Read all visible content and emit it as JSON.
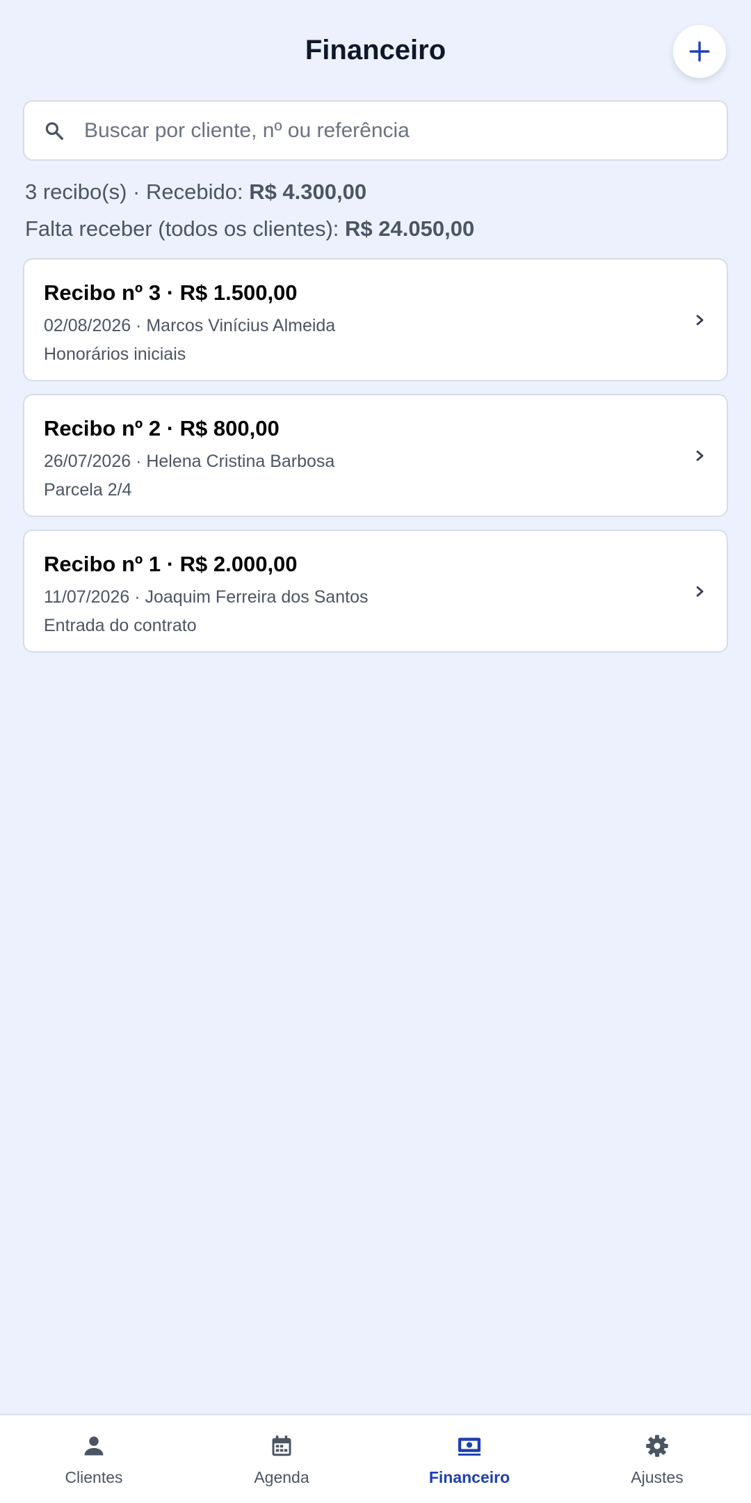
{
  "header": {
    "title": "Financeiro",
    "add_icon": "plus-icon"
  },
  "search": {
    "placeholder": "Buscar por cliente, nº ou referência",
    "value": "",
    "icon": "search-icon"
  },
  "summary": {
    "count_text": "3 recibo(s) · Recebido: ",
    "received_amount": "R$ 4.300,00",
    "pending_label": "Falta receber (todos os clientes): ",
    "pending_amount": "R$ 24.050,00"
  },
  "receipts": [
    {
      "title": "Recibo nº 3 · R$ 1.500,00",
      "meta": "02/08/2026 · Marcos Vinícius Almeida",
      "note": "Honorários iniciais"
    },
    {
      "title": "Recibo nº 2 · R$ 800,00",
      "meta": "26/07/2026 · Helena Cristina Barbosa",
      "note": "Parcela 2/4"
    },
    {
      "title": "Recibo nº 1 · R$ 2.000,00",
      "meta": "11/07/2026 · Joaquim Ferreira dos Santos",
      "note": "Entrada do contrato"
    }
  ],
  "nav": {
    "items": [
      {
        "label": "Clientes",
        "icon": "person-icon",
        "active": false
      },
      {
        "label": "Agenda",
        "icon": "calendar-icon",
        "active": false
      },
      {
        "label": "Financeiro",
        "icon": "money-icon",
        "active": true
      },
      {
        "label": "Ajustes",
        "icon": "gear-icon",
        "active": false
      }
    ]
  },
  "colors": {
    "background": "#ECF1FD",
    "accent": "#1E40AF",
    "muted_text": "#4B5563",
    "icon_gray": "#4B5563"
  }
}
